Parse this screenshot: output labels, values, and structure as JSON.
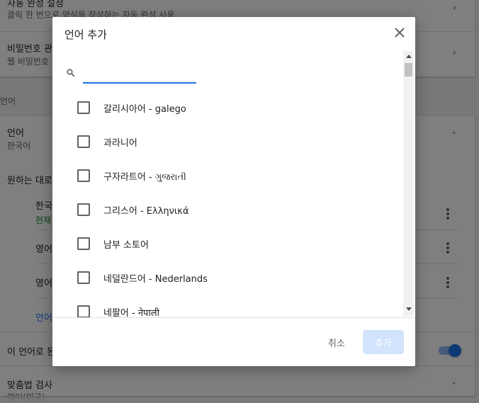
{
  "background": {
    "autofill": {
      "title": "자동 완성 설정",
      "subtitle": "클릭 한 번으로 양식을 작성하는 자동 완성 사용"
    },
    "passwords": {
      "title": "비밀번호 관",
      "subtitle": "웹 비밀번호"
    },
    "section_label": "언어",
    "language": {
      "title": "언어",
      "subtitle": "한국어"
    },
    "preferred_label": "원하는 대로",
    "rows": [
      {
        "title": "한국",
        "subtitle": "현재"
      },
      {
        "title": "영어"
      },
      {
        "title": "영어"
      }
    ],
    "add_link": "언어",
    "offer_translate": "이 언어로 된",
    "spellcheck": {
      "title": "맞춤법 검사",
      "subtitle": "영어(미국)"
    }
  },
  "dialog": {
    "title": "언어 추가",
    "search": {
      "value": "",
      "placeholder": ""
    },
    "languages": [
      {
        "label": "갈리시아어 - galego",
        "checked": false
      },
      {
        "label": "과라니어",
        "checked": false
      },
      {
        "label": "구자라트어 - ગુજરાતી",
        "checked": false
      },
      {
        "label": "그리스어 - Ελληνικά",
        "checked": false
      },
      {
        "label": "남부 소토어",
        "checked": false
      },
      {
        "label": "네덜란드어 - Nederlands",
        "checked": false
      },
      {
        "label": "네팔어 - नेपाली",
        "checked": false
      }
    ],
    "cancel_label": "취소",
    "add_label": "추가"
  },
  "colors": {
    "accent": "#1a73e8",
    "add_button_disabled": "#d2e3fc",
    "link": "#1a73e8",
    "current_badge": "#188038"
  }
}
